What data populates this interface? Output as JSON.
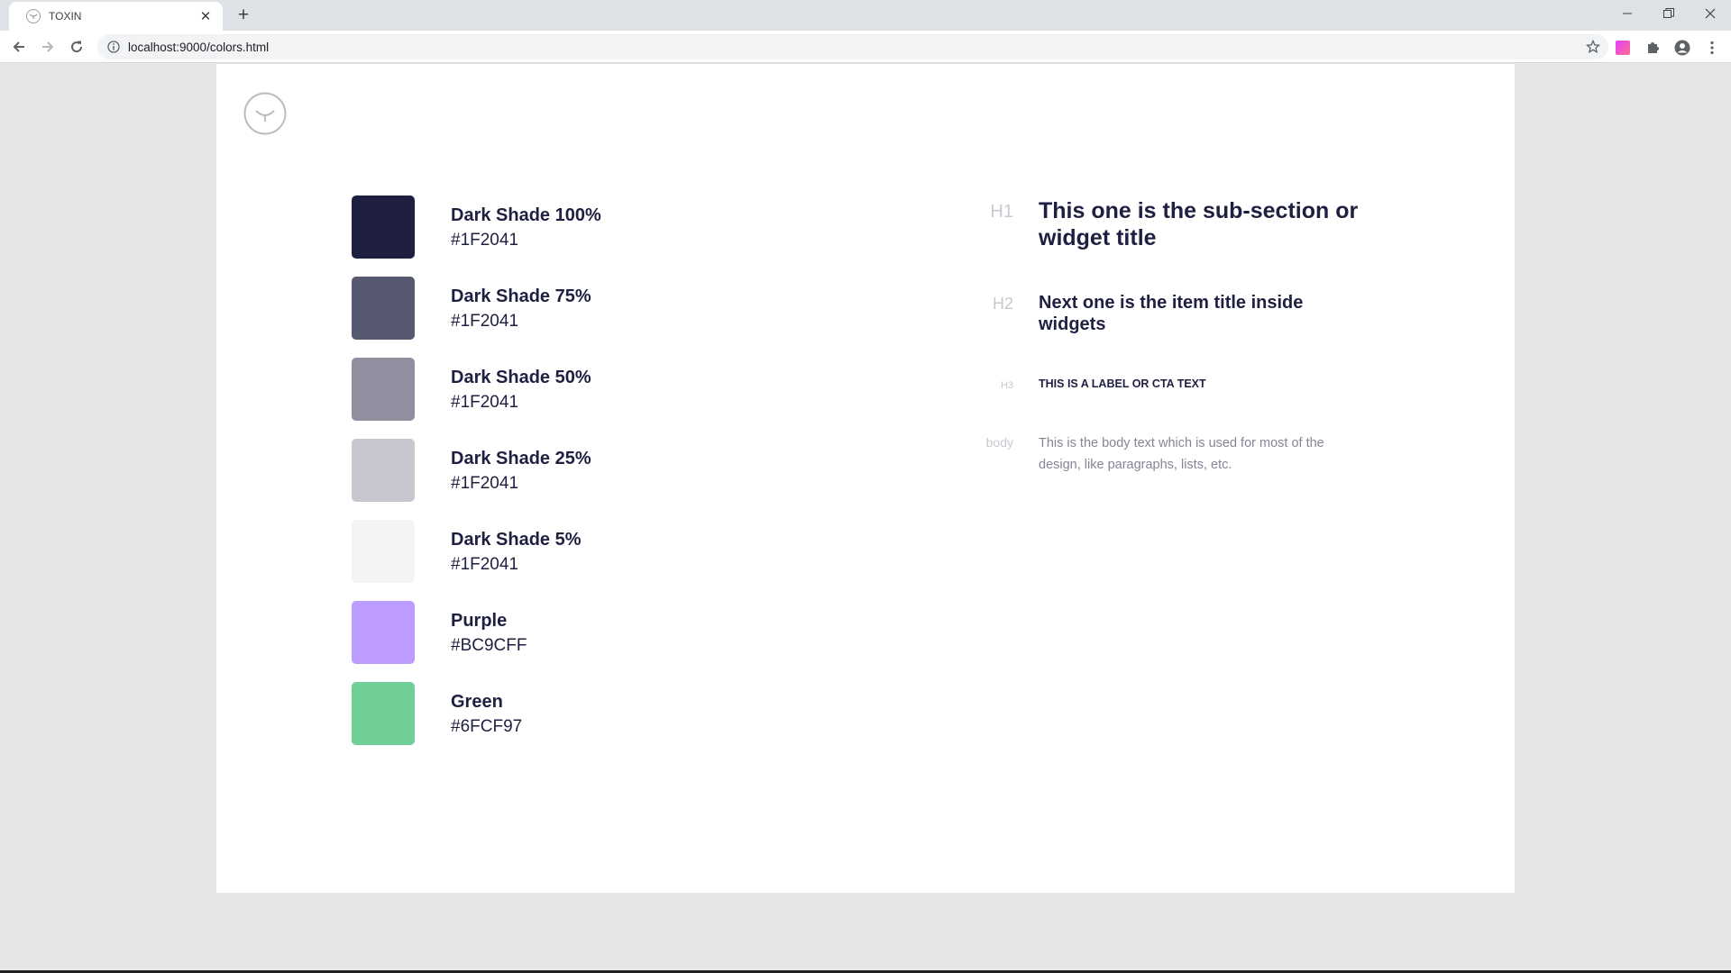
{
  "browser": {
    "tab_title": "TOXIN",
    "url": "localhost:9000/colors.html"
  },
  "colors": {
    "dark_100": "#1F2041",
    "dark_75": "#575971",
    "dark_50": "#8F8FA0",
    "dark_25": "#C7C7CF",
    "dark_5": "#F4F4F5",
    "purple": "#BC9CFF",
    "green": "#6FCF97"
  },
  "swatches": [
    {
      "name": "Dark Shade 100%",
      "hex": "#1F2041"
    },
    {
      "name": "Dark Shade 75%",
      "hex": "#1F2041"
    },
    {
      "name": "Dark Shade 50%",
      "hex": "#1F2041"
    },
    {
      "name": "Dark Shade 25%",
      "hex": "#1F2041"
    },
    {
      "name": "Dark Shade 5%",
      "hex": "#1F2041"
    },
    {
      "name": "Purple",
      "hex": "#BC9CFF"
    },
    {
      "name": "Green",
      "hex": "#6FCF97"
    }
  ],
  "typography": {
    "h1": {
      "label": "H1",
      "sample": "This one is the sub-section or widget title"
    },
    "h2": {
      "label": "H2",
      "sample": "Next one is the item title inside widgets"
    },
    "h3": {
      "label": "H3",
      "sample": "THIS IS A LABEL OR CTA TEXT"
    },
    "body": {
      "label": "body",
      "sample": "This is the body text which is used for most of the design, like paragraphs, lists, etc."
    }
  },
  "icons": {
    "favicon": "toxin-logo-icon",
    "close": "close-icon",
    "new_tab": "plus-icon",
    "back": "back-arrow-icon",
    "forward": "forward-arrow-icon",
    "reload": "reload-icon",
    "info": "info-icon",
    "star": "star-icon",
    "extension": "puzzle-icon",
    "profile": "profile-icon",
    "menu": "kebab-menu-icon"
  }
}
